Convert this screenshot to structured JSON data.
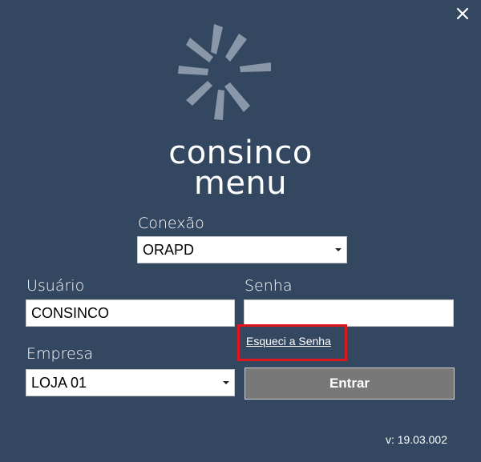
{
  "brand": {
    "line1": "consinco",
    "line2": "menu"
  },
  "conexao": {
    "label": "Conexão",
    "value": "ORAPD"
  },
  "usuario": {
    "label": "Usuário",
    "value": "CONSINCO"
  },
  "senha": {
    "label": "Senha",
    "value": ""
  },
  "forgot_password": {
    "label": "Esqueci a Senha",
    "highlight_color": "#e0141d"
  },
  "empresa": {
    "label": "Empresa",
    "value": "LOJA 01"
  },
  "enter_button": {
    "label": "Entrar"
  },
  "version": "v: 19.03.002",
  "colors": {
    "background": "#344760",
    "button": "#787878",
    "logo": "#8a97a8"
  },
  "icons": {
    "close": "close-icon",
    "logo": "sunburst-logo-icon",
    "dropdown": "chevron-down-icon"
  }
}
